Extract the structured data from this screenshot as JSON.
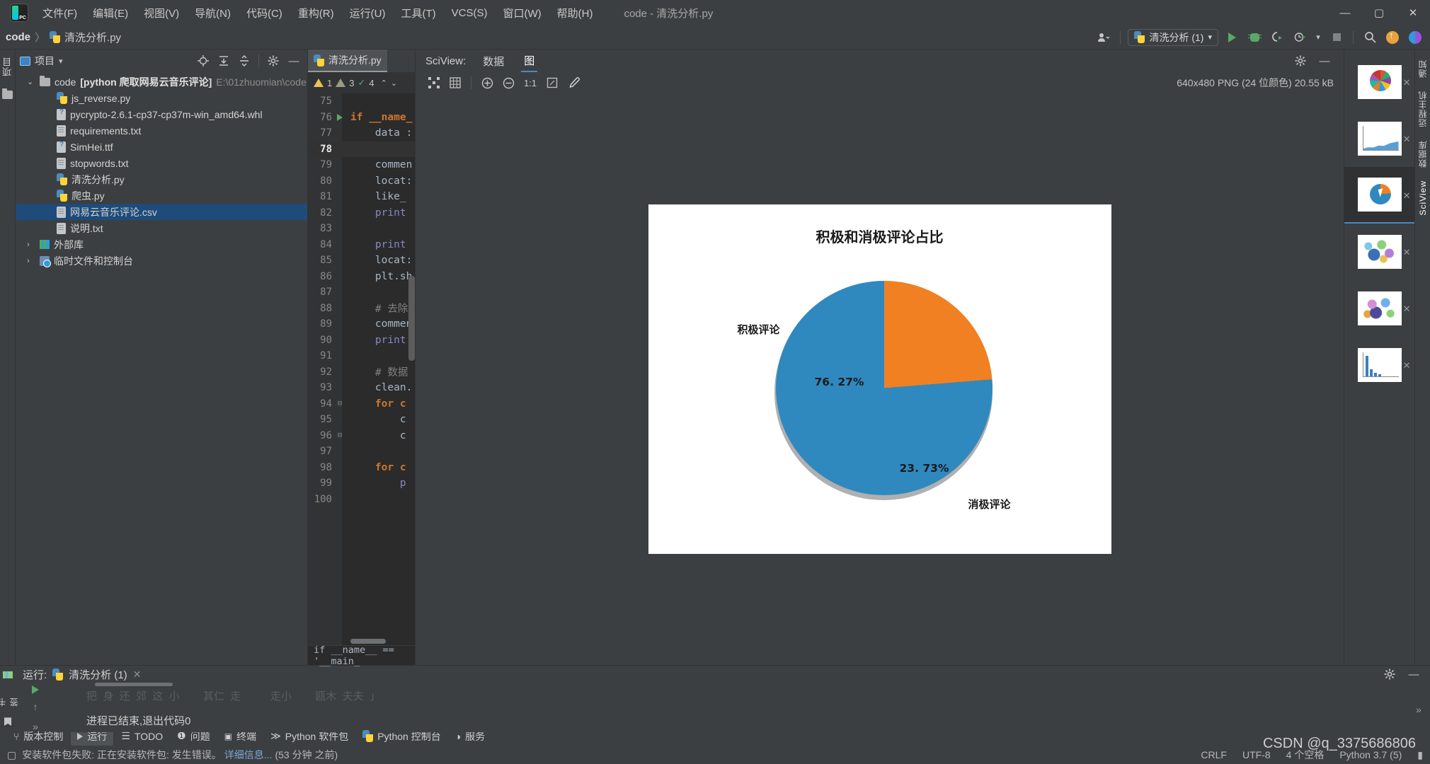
{
  "titlebar": {
    "logo_icon": "pycharm-logo-icon",
    "menus": [
      "文件(F)",
      "编辑(E)",
      "视图(V)",
      "导航(N)",
      "代码(C)",
      "重构(R)",
      "运行(U)",
      "工具(T)",
      "VCS(S)",
      "窗口(W)",
      "帮助(H)"
    ],
    "window_title": "code - 清洗分析.py",
    "minimize": "—",
    "maximize": "▢",
    "close": "✕"
  },
  "navbar": {
    "breadcrumb": [
      "code",
      "清洗分析.py"
    ],
    "separator": "〉",
    "run_config": "清洗分析 (1)",
    "chevron": "▾"
  },
  "left_strip": {
    "tabs": [
      "项目"
    ]
  },
  "project": {
    "title": "项目",
    "root": {
      "label": "code",
      "bracket": "[python 爬取网易云音乐评论]",
      "path": "E:\\01zhuomian\\code"
    },
    "files": [
      {
        "name": "js_reverse.py",
        "icon": "python-file-icon"
      },
      {
        "name": "pycrypto-2.6.1-cp37-cp37m-win_amd64.whl",
        "icon": "unknown-file-icon"
      },
      {
        "name": "requirements.txt",
        "icon": "text-file-icon"
      },
      {
        "name": "SimHei.ttf",
        "icon": "unknown-file-icon"
      },
      {
        "name": "stopwords.txt",
        "icon": "text-file-icon"
      },
      {
        "name": "清洗分析.py",
        "icon": "python-file-icon"
      },
      {
        "name": "爬虫.py",
        "icon": "python-file-icon"
      },
      {
        "name": "网易云音乐评论.csv",
        "icon": "text-file-icon",
        "selected": true
      },
      {
        "name": "说明.txt",
        "icon": "text-file-icon"
      }
    ],
    "nodes": [
      {
        "label": "外部库",
        "icon": "library-icon"
      },
      {
        "label": "临时文件和控制台",
        "icon": "scratches-icon"
      }
    ]
  },
  "editor": {
    "tab": "清洗分析.py",
    "inspections": {
      "warnings": "1",
      "weak_warnings": "3",
      "checks": "4"
    },
    "lines": [
      {
        "n": "75",
        "code": ""
      },
      {
        "n": "76",
        "code": "if __name_",
        "run": true,
        "fold": true
      },
      {
        "n": "77",
        "code": "    data :"
      },
      {
        "n": "78",
        "code": "",
        "current": true
      },
      {
        "n": "79",
        "code": "    commen"
      },
      {
        "n": "80",
        "code": "    locat:"
      },
      {
        "n": "81",
        "code": "    like_"
      },
      {
        "n": "82",
        "code": "    print"
      },
      {
        "n": "83",
        "code": ""
      },
      {
        "n": "84",
        "code": "    print"
      },
      {
        "n": "85",
        "code": "    locat:"
      },
      {
        "n": "86",
        "code": "    plt.sh"
      },
      {
        "n": "87",
        "code": ""
      },
      {
        "n": "88",
        "code": "    # 去除"
      },
      {
        "n": "89",
        "code": "    commen"
      },
      {
        "n": "90",
        "code": "    print"
      },
      {
        "n": "91",
        "code": ""
      },
      {
        "n": "92",
        "code": "    # 数据"
      },
      {
        "n": "93",
        "code": "    clean."
      },
      {
        "n": "94",
        "code": "    for c",
        "fold": true
      },
      {
        "n": "95",
        "code": "        c"
      },
      {
        "n": "96",
        "code": "        c",
        "fold": true
      },
      {
        "n": "97",
        "code": ""
      },
      {
        "n": "98",
        "code": "    for c"
      },
      {
        "n": "99",
        "code": "        p"
      },
      {
        "n": "100",
        "code": ""
      }
    ],
    "status_line": "if __name__ == '__main_"
  },
  "sciview": {
    "label": "SciView:",
    "tabs": [
      {
        "label": "数据",
        "active": false
      },
      {
        "label": "图",
        "active": true
      }
    ],
    "toolbar_icons": [
      "fit-content-icon",
      "grid-icon",
      "zoom-in-icon",
      "zoom-out-icon",
      "actual-size-icon",
      "fit-window-icon",
      "color-picker-icon"
    ],
    "zoom_label": "1:1",
    "image_info": "640x480 PNG (24 位颜色) 20.55 kB"
  },
  "chart_data": {
    "type": "pie",
    "title": "积极和消极评论占比",
    "categories": [
      "积极评论",
      "消极评论"
    ],
    "values": [
      76.27,
      23.73
    ],
    "labels": [
      "76. 27%",
      "23. 73%"
    ],
    "colors": [
      "#2f89bf",
      "#f08022"
    ],
    "startangle": 0,
    "shadow": true,
    "legend": "none",
    "xlabel": "",
    "ylabel": ""
  },
  "thumbnails": [
    {
      "name": "thumb-multicolor-pie",
      "close": "✕",
      "selected": false
    },
    {
      "name": "thumb-area-chart",
      "close": "✕",
      "selected": false
    },
    {
      "name": "thumb-blue-orange-pie",
      "close": "✕",
      "selected": true
    },
    {
      "name": "thumb-wordcloud-1",
      "close": "✕",
      "selected": false
    },
    {
      "name": "thumb-wordcloud-2",
      "close": "✕",
      "selected": false
    },
    {
      "name": "thumb-bar-chart",
      "close": "✕",
      "selected": false
    }
  ],
  "right_strip": {
    "tabs": [
      "通知",
      "远程主机",
      "数据库",
      "SciView"
    ]
  },
  "run_panel": {
    "label": "运行:",
    "config": "清洗分析 (1)",
    "close": "✕",
    "ghost_text": "把  身  还  郊  这  小        其仁  走          走小        瓯木  夫夫  」",
    "output": "进程已结束,退出代码0"
  },
  "tool_windows": [
    {
      "label": "版本控制",
      "icon": "branch-icon",
      "active": false
    },
    {
      "label": "运行",
      "icon": "play-icon",
      "active": true
    },
    {
      "label": "TODO",
      "icon": "todo-icon",
      "active": false
    },
    {
      "label": "问题",
      "icon": "problems-icon",
      "active": false
    },
    {
      "label": "终端",
      "icon": "terminal-icon",
      "active": false
    },
    {
      "label": "Python 软件包",
      "icon": "packages-icon",
      "active": false
    },
    {
      "label": "Python 控制台",
      "icon": "python-console-icon",
      "active": false
    },
    {
      "label": "服务",
      "icon": "services-icon",
      "active": false
    }
  ],
  "statusbar": {
    "message": "安装软件包失败: 正在安装软件包: 发生错误。",
    "details_link": "详细信息...",
    "time": "(53 分钟 之前)",
    "right": [
      "CRLF",
      "UTF-8",
      "4 个空格",
      "Python 3.7 (5)"
    ],
    "watermark": "CSDN @q_3375686806"
  }
}
